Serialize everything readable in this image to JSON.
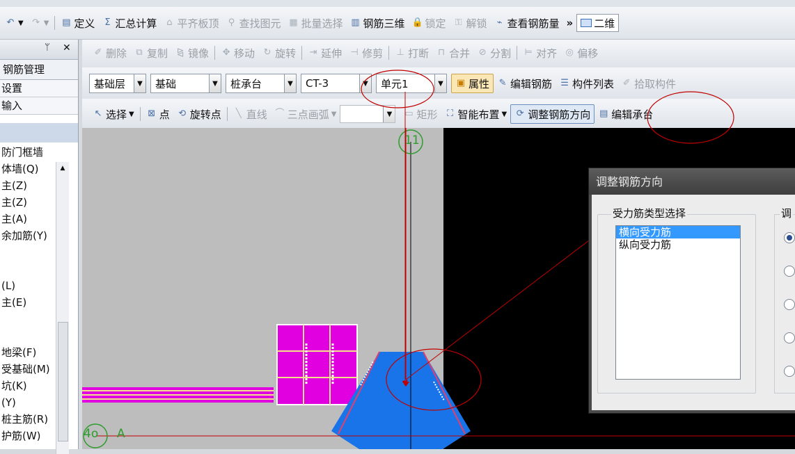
{
  "toolbar1": {
    "items": [
      {
        "label": "定义",
        "icon": "define-icon",
        "enabled": true
      },
      {
        "label": "汇总计算",
        "icon": "sum-icon",
        "enabled": true
      },
      {
        "label": "平齐板顶",
        "icon": "align-top-icon",
        "enabled": false
      },
      {
        "label": "查找图元",
        "icon": "binoculars-icon",
        "enabled": false
      },
      {
        "label": "批量选择",
        "icon": "batch-select-icon",
        "enabled": false
      },
      {
        "label": "钢筋三维",
        "icon": "rebar-3d-icon",
        "enabled": true
      },
      {
        "label": "锁定",
        "icon": "lock-icon",
        "enabled": false
      },
      {
        "label": "解锁",
        "icon": "unlock-icon",
        "enabled": false
      },
      {
        "label": "查看钢筋量",
        "icon": "view-rebar-icon",
        "enabled": true
      }
    ],
    "more": "»",
    "view_label": "二维"
  },
  "panel": {
    "tab_label": "钢筋管理",
    "pin": "ᛘ",
    "close": "✕",
    "rows": [
      "设置",
      "输入"
    ],
    "items": [
      "防门框墙",
      "体墙(Q)",
      "主(Z)",
      "主(Z)",
      "主(A)",
      "余加筋(Y)",
      "",
      "",
      "(L)",
      "主(E)",
      "",
      "",
      "地梁(F)",
      "受基础(M)",
      "坑(K)",
      "(Y)",
      "桩主筋(R)",
      "护筋(W)"
    ]
  },
  "toolbar2": {
    "items": [
      {
        "label": "删除",
        "icon": "delete-icon"
      },
      {
        "label": "复制",
        "icon": "copy-icon"
      },
      {
        "label": "镜像",
        "icon": "mirror-icon"
      },
      {
        "label": "移动",
        "icon": "move-icon"
      },
      {
        "label": "旋转",
        "icon": "rotate-icon"
      },
      {
        "label": "延伸",
        "icon": "extend-icon"
      },
      {
        "label": "修剪",
        "icon": "trim-icon"
      },
      {
        "label": "打断",
        "icon": "break-icon"
      },
      {
        "label": "合并",
        "icon": "merge-icon"
      },
      {
        "label": "分割",
        "icon": "split-icon"
      },
      {
        "label": "对齐",
        "icon": "align-icon"
      },
      {
        "label": "偏移",
        "icon": "offset-icon"
      }
    ]
  },
  "toolbar3": {
    "floor": "基础层",
    "category": "基础",
    "type": "桩承台",
    "component": "CT-3",
    "unit": "单元1",
    "property_label": "属性",
    "edit_rebar_label": "编辑钢筋",
    "component_list_label": "构件列表",
    "pick_label": "拾取构件"
  },
  "toolbar4": {
    "select_label": "选择",
    "point_label": "点",
    "rotate_point_label": "旋转点",
    "line_label": "直线",
    "arc_label": "三点画弧",
    "rect_label": "矩形",
    "smart_label": "智能布置",
    "adjust_label": "调整钢筋方向",
    "edit_cap_label": "编辑承台"
  },
  "canvas": {
    "axis_top": "11",
    "axis_left": "4o",
    "axis_left_suffix": "A"
  },
  "dialog": {
    "title": "调整钢筋方向",
    "group_label": "受力筋类型选择",
    "group2_label": "调",
    "options": [
      "横向受力筋",
      "纵向受力筋"
    ],
    "selected_index": 0
  },
  "colors": {
    "annotation": "#c00000",
    "canvas_black": "#000000",
    "canvas_gray": "#bdbdbd",
    "cap_blue": "#1874e8",
    "magenta": "#e000e0",
    "axis_green": "#2e9b2e"
  }
}
